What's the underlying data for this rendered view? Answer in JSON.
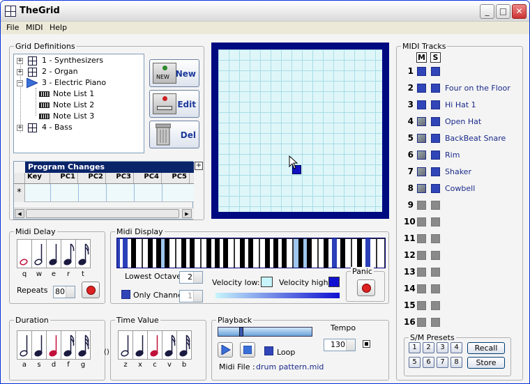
{
  "window": {
    "title": "TheGrid",
    "min": "_",
    "max": "□",
    "close": "✕"
  },
  "menu": [
    "File",
    "MIDI",
    "Help"
  ],
  "grid_definitions": {
    "label": "Grid Definitions",
    "tree": [
      {
        "label": "1 - Synthesizers",
        "expand": "+"
      },
      {
        "label": "2 - Organ",
        "expand": "+"
      },
      {
        "label": "3 - Electric Piano",
        "expand": "−"
      },
      {
        "label": "Note List 1"
      },
      {
        "label": "Note List 2"
      },
      {
        "label": "Note List 3"
      },
      {
        "label": "4 - Bass",
        "expand": "+"
      }
    ],
    "buttons": {
      "new": "New",
      "new_icon_text": "NEW",
      "edit": "Edit",
      "del": "Del"
    }
  },
  "program_changes": {
    "title": "Program Changes",
    "expand": "+",
    "columns": [
      "Key",
      "PC1",
      "PC2",
      "PC3",
      "PC4",
      "PC5"
    ],
    "new_row_marker": "*",
    "scroll_left": "◀",
    "scroll_right": "▶"
  },
  "grid": {
    "active_cells": [
      {
        "col": 7,
        "row": 11
      }
    ]
  },
  "midi_delay": {
    "label": "Midi Delay",
    "keys": [
      "q",
      "w",
      "e",
      "r",
      "t"
    ],
    "repeats_label": "Repeats",
    "repeats_value": "80"
  },
  "midi_display": {
    "label": "Midi Display",
    "lowest_octave_label": "Lowest Octave",
    "lowest_octave_value": "2",
    "only_channel_label": "Only Channel",
    "only_channel_value": "1",
    "velocity_low_label": "Velocity low:",
    "velocity_high_label": "Velocity high:",
    "panic_label": "Panic",
    "colors": {
      "velocity_low": "#c8f4fb",
      "velocity_high": "#1010d0",
      "highlight_key": "#9fc7ee"
    }
  },
  "duration": {
    "label": "Duration",
    "keys": [
      "a",
      "s",
      "d",
      "f",
      "g"
    ]
  },
  "time_value": {
    "label": "Time Value",
    "keys": [
      "z",
      "x",
      "c",
      "v",
      "b"
    ],
    "separator": "()"
  },
  "playback": {
    "label": "Playback",
    "tempo_label": "Tempo",
    "tempo_value": "130",
    "loop_label": "Loop",
    "midi_file_label": "Midi File :",
    "midi_file_name": "drum pattern.mid",
    "progress": 0.22
  },
  "midi_tracks": {
    "label": "MIDI Tracks",
    "m_label": "M",
    "s_label": "S",
    "tracks": [
      {
        "num": "1",
        "name": "",
        "active": true
      },
      {
        "num": "2",
        "name": "Four on the Floor",
        "active": true
      },
      {
        "num": "3",
        "name": "Hi Hat 1",
        "active": true
      },
      {
        "num": "4",
        "name": "Open Hat",
        "active": true
      },
      {
        "num": "5",
        "name": "BackBeat Snare",
        "active": true
      },
      {
        "num": "6",
        "name": "Rim",
        "active": true
      },
      {
        "num": "7",
        "name": "Shaker",
        "active": true
      },
      {
        "num": "8",
        "name": "Cowbell",
        "active": true
      },
      {
        "num": "9",
        "name": "",
        "active": false
      },
      {
        "num": "10",
        "name": "",
        "active": false
      },
      {
        "num": "11",
        "name": "",
        "active": false
      },
      {
        "num": "12",
        "name": "",
        "active": false
      },
      {
        "num": "13",
        "name": "",
        "active": false
      },
      {
        "num": "14",
        "name": "",
        "active": false
      },
      {
        "num": "15",
        "name": "",
        "active": false
      },
      {
        "num": "16",
        "name": "",
        "active": false
      }
    ]
  },
  "presets": {
    "label": "S/M Presets",
    "buttons": [
      "1",
      "2",
      "3",
      "4",
      "5",
      "6",
      "7",
      "8"
    ],
    "recall": "Recall",
    "store": "Store"
  }
}
